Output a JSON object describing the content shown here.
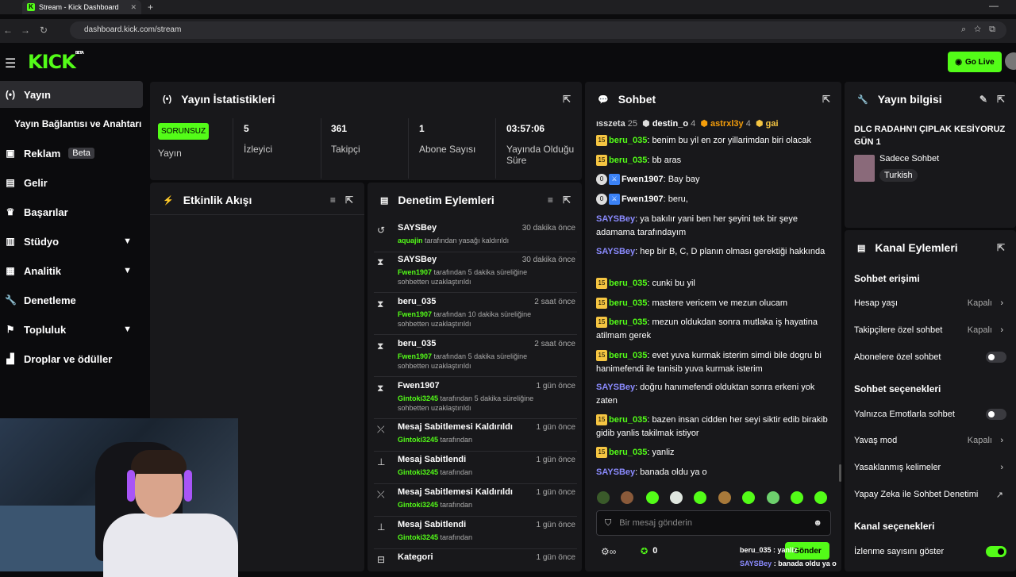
{
  "browser": {
    "tab_title": "Stream - Kick Dashboard",
    "url": "dashboard.kick.com/stream"
  },
  "header": {
    "logo": "KICK",
    "logo_tag": "BETA",
    "go_live": "Go Live"
  },
  "sidebar": {
    "items": [
      {
        "label": "Yayın",
        "icon": "broadcast-icon"
      },
      {
        "label": "Yayın Bağlantısı ve Anahtarı",
        "icon": ""
      },
      {
        "label": "Reklam",
        "icon": "ad-icon",
        "badge": "Beta"
      },
      {
        "label": "Gelir",
        "icon": "revenue-icon"
      },
      {
        "label": "Başarılar",
        "icon": "trophy-icon"
      },
      {
        "label": "Stüdyo",
        "icon": "studio-icon"
      },
      {
        "label": "Analitik",
        "icon": "analytics-icon"
      },
      {
        "label": "Denetleme",
        "icon": "wrench-icon"
      },
      {
        "label": "Topluluk",
        "icon": "community-icon"
      },
      {
        "label": "Droplar ve ödüller",
        "icon": "drops-icon"
      }
    ]
  },
  "stats": {
    "title": "Yayın İstatistikleri",
    "status_badge": "SORUNSUZ",
    "status_label": "Yayın",
    "cells": [
      {
        "value": "5",
        "label": "İzleyici"
      },
      {
        "value": "361",
        "label": "Takipçi"
      },
      {
        "value": "1",
        "label": "Abone Sayısı"
      },
      {
        "value": "03:57:06",
        "label": "Yayında Olduğu Süre"
      }
    ]
  },
  "activity": {
    "title": "Etkinlik Akışı"
  },
  "moderation": {
    "title": "Denetim Eylemleri",
    "items": [
      {
        "title": "SAYSBey",
        "time": "30 dakika önce",
        "who": "aquajin",
        "text": " tarafından yasağı kaldırıldı"
      },
      {
        "title": "SAYSBey",
        "time": "30 dakika önce",
        "who": "Fwen1907",
        "text": " tarafından 5 dakika süreliğine sohbetten uzaklaştırıldı"
      },
      {
        "title": "beru_035",
        "time": "2 saat önce",
        "who": "Fwen1907",
        "text": " tarafından 10 dakika süreliğine sohbetten uzaklaştırıldı"
      },
      {
        "title": "beru_035",
        "time": "2 saat önce",
        "who": "Fwen1907",
        "text": " tarafından 5 dakika süreliğine sohbetten uzaklaştırıldı"
      },
      {
        "title": "Fwen1907",
        "time": "1 gün önce",
        "who": "Gintoki3245",
        "text": " tarafından 5 dakika süreliğine sohbetten uzaklaştırıldı"
      },
      {
        "title": "Mesaj Sabitlemesi Kaldırıldı",
        "time": "1 gün önce",
        "who": "Gintoki3245",
        "text": " tarafından"
      },
      {
        "title": "Mesaj Sabitlendi",
        "time": "1 gün önce",
        "who": "Gintoki3245",
        "text": " tarafından"
      },
      {
        "title": "Mesaj Sabitlemesi Kaldırıldı",
        "time": "1 gün önce",
        "who": "Gintoki3245",
        "text": " tarafından"
      },
      {
        "title": "Mesaj Sabitlendi",
        "time": "1 gün önce",
        "who": "Gintoki3245",
        "text": " tarafından"
      },
      {
        "title": "Kategori",
        "time": "1 gün önce",
        "who": "",
        "text": ""
      }
    ]
  },
  "chat": {
    "title": "Sohbet",
    "leaderboard": [
      {
        "name": "ısszeta",
        "count": "25"
      },
      {
        "name": "destin_o",
        "count": "4"
      },
      {
        "name": "astrxl3y",
        "count": "4"
      },
      {
        "name": "gai",
        "count": ""
      }
    ],
    "messages": [
      {
        "badge": "15",
        "user": "beru_035",
        "color": "green",
        "text": "benim bu yil en zor yillarimdan biri olacak"
      },
      {
        "badge": "15",
        "user": "beru_035",
        "color": "green",
        "text": "bb aras"
      },
      {
        "badge": "0",
        "user": "Fwen1907",
        "color": "white",
        "text": "Bay bay"
      },
      {
        "badge": "0",
        "user": "Fwen1907",
        "color": "white",
        "text": "beru,"
      },
      {
        "badge": "",
        "user": "SAYSBey",
        "color": "purple",
        "text": "ya bakılır yani ben her şeyini tek bir şeye adamama tarafındayım"
      },
      {
        "badge": "",
        "user": "SAYSBey",
        "color": "purple",
        "text": "hep bir B, C, D planın olması gerektiği hakkında"
      },
      {
        "badge": "15",
        "user": "beru_035",
        "color": "green",
        "text": "cunki bu yil"
      },
      {
        "badge": "15",
        "user": "beru_035",
        "color": "green",
        "text": "mastere vericem ve mezun olucam"
      },
      {
        "badge": "15",
        "user": "beru_035",
        "color": "green",
        "text": "mezun oldukdan sonra mutlaka iş hayatina atilmam gerek"
      },
      {
        "badge": "15",
        "user": "beru_035",
        "color": "green",
        "text": "evet yuva kurmak isterim simdi bile dogru bi hanimefendi ile tanisib yuva kurmak isterim"
      },
      {
        "badge": "",
        "user": "SAYSBey",
        "color": "purple",
        "text": "doğru hanımefendi olduktan sonra erkeni yok zaten"
      },
      {
        "badge": "15",
        "user": "beru_035",
        "color": "green",
        "text": "bazen insan cidden her seyi siktir edib birakib gidib yanlis takilmak istiyor"
      },
      {
        "badge": "15",
        "user": "beru_035",
        "color": "green",
        "text": "yanliz"
      },
      {
        "badge": "",
        "user": "SAYSBey",
        "color": "purple",
        "text": "banada oldu ya o"
      }
    ],
    "input_placeholder": "Bir mesaj gönderin",
    "points": "0",
    "send_label": "Gönder"
  },
  "stream_info": {
    "title": "Yayın bilgisi",
    "stream_title": "DLC RADAHN'I ÇIPLAK KESİYORUZ GÜN 1",
    "category": "Sadece Sohbet",
    "tag": "Turkish"
  },
  "channel_actions": {
    "title": "Kanal Eylemleri",
    "chat_access_title": "Sohbet erişimi",
    "age": {
      "label": "Hesap yaşı",
      "value": "Kapalı"
    },
    "followers": {
      "label": "Takipçilere özel sohbet",
      "value": "Kapalı"
    },
    "subs": {
      "label": "Abonelere özel sohbet"
    },
    "chat_options_title": "Sohbet seçenekleri",
    "emote_only": {
      "label": "Yalnızca Emotlarla sohbet"
    },
    "slow": {
      "label": "Yavaş mod",
      "value": "Kapalı"
    },
    "banned_words": {
      "label": "Yasaklanmış kelimeler"
    },
    "ai_mod": {
      "label": "Yapay Zeka ile Sohbet Denetimi"
    },
    "channel_options_title": "Kanal seçenekleri",
    "viewer_count": {
      "label": "İzlenme sayısını göster"
    }
  },
  "overlay": {
    "line1_user": "beru_035",
    "line1_text": " : yanliz",
    "line2_user": "SAYSBey",
    "line2_text": " : banada oldu ya o"
  }
}
